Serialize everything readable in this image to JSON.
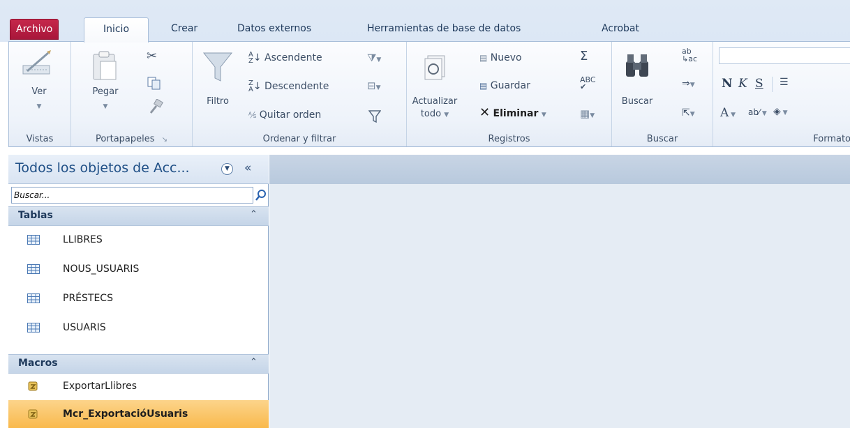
{
  "tabs": {
    "archivo": "Archivo",
    "inicio": "Inicio",
    "crear": "Crear",
    "datos_externos": "Datos externos",
    "herramientas": "Herramientas de base de datos",
    "acrobat": "Acrobat"
  },
  "ribbon": {
    "vistas": {
      "label": "Vistas",
      "ver": "Ver"
    },
    "portapapeles": {
      "label": "Portapapeles",
      "pegar": "Pegar"
    },
    "ordenar": {
      "label": "Ordenar y filtrar",
      "filtro": "Filtro",
      "ascendente": "Ascendente",
      "descendente": "Descendente",
      "quitar_orden": "Quitar orden"
    },
    "registros": {
      "label": "Registros",
      "actualizar": "Actualizar",
      "todo": "todo",
      "nuevo": "Nuevo",
      "guardar": "Guardar",
      "eliminar": "Eliminar"
    },
    "buscar": {
      "label": "Buscar",
      "buscar": "Buscar"
    },
    "formato": {
      "label": "Formato",
      "bold": "N",
      "italic": "K",
      "underline": "S",
      "font_a": "A"
    }
  },
  "nav": {
    "title": "Todos los objetos de Acc...",
    "search_placeholder": "Buscar...",
    "sections": {
      "tablas": {
        "label": "Tablas",
        "items": [
          "LLIBRES",
          "NOUS_USUARIS",
          "PRÉSTECS",
          "USUARIS"
        ]
      },
      "macros": {
        "label": "Macros",
        "items": [
          "ExportarLlibres",
          "Mcr_ExportacióUsuaris"
        ]
      }
    }
  },
  "colors": {
    "archivo_tab": "#b61e43",
    "selected_item": "#f9c165",
    "ribbon_bg": "#eef3fa",
    "nav_header": "#dbe5f2",
    "workspace": "#e5ecf4"
  }
}
